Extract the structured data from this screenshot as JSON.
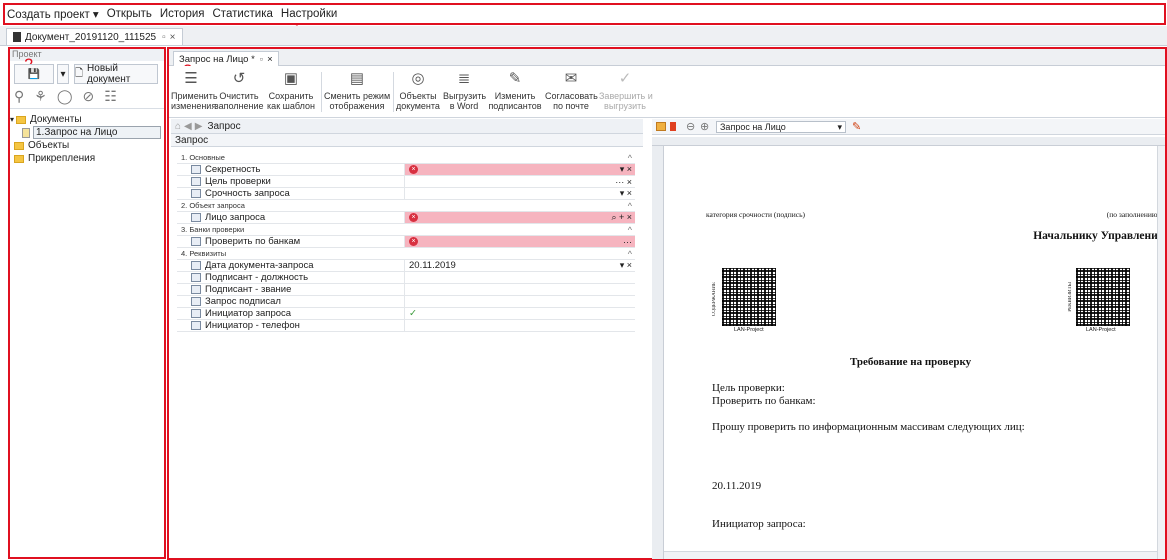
{
  "menu": {
    "items": [
      "Создать проект ▾",
      "Открыть",
      "История",
      "Статистика",
      "Настройки"
    ],
    "marker": "1"
  },
  "doc_tab": {
    "label": "Документ_20191120_111525",
    "pin": "▫",
    "close": "×"
  },
  "left_panel": {
    "title": "Проект",
    "marker": "2",
    "new_doc_label": "Новый документ",
    "tree": [
      {
        "label": "Документы",
        "level": 0
      },
      {
        "label": "1.Запрос на Лицо",
        "level": 1
      },
      {
        "label": "Объекты",
        "level": 0
      },
      {
        "label": "Прикрепления",
        "level": 0
      }
    ]
  },
  "main_tab": {
    "label": "Запрос на Лицо *",
    "pin": "▫",
    "close": "×",
    "marker": "3"
  },
  "ribbon": [
    {
      "label": "Применить\nизменения",
      "icon": "apply-icon",
      "glyph": "☰"
    },
    {
      "label": "Очистить\nзаполнение",
      "icon": "reset-icon",
      "glyph": "↺"
    },
    {
      "label": "Сохранить\nкак шаблон",
      "icon": "save-template-icon",
      "glyph": "▣"
    },
    {
      "label": "Сменить режим\nотображения",
      "icon": "display-mode-icon",
      "glyph": "▤"
    },
    {
      "label": "Объекты\nдокумента",
      "icon": "objects-icon",
      "glyph": "◎"
    },
    {
      "label": "Выгрузить\nв Word",
      "icon": "export-word-icon",
      "glyph": "≣"
    },
    {
      "label": "Изменить\nподписантов",
      "icon": "signers-icon",
      "glyph": "✎"
    },
    {
      "label": "Согласовать\nпо почте",
      "icon": "mail-icon",
      "glyph": "✉"
    },
    {
      "label": "Завершить и\nвыгрузить",
      "icon": "finish-icon",
      "glyph": "✓"
    }
  ],
  "form": {
    "breadcrumb": "Запрос",
    "header": "Запрос",
    "groups": [
      {
        "title": "1. Основные",
        "rows": [
          {
            "label": "Секретность",
            "value": "",
            "required": true,
            "actions": "▾ ×"
          },
          {
            "label": "Цель проверки",
            "value": "",
            "required": false,
            "actions": "··· ×"
          },
          {
            "label": "Срочность запроса",
            "value": "",
            "required": false,
            "actions": "▾ ×"
          }
        ]
      },
      {
        "title": "2. Объект запроса",
        "rows": [
          {
            "label": "Лицо запроса",
            "value": "",
            "required": true,
            "actions": "⌕ + ×"
          }
        ]
      },
      {
        "title": "3. Банки проверки",
        "rows": [
          {
            "label": "Проверить по банкам",
            "value": "",
            "required": true,
            "actions": "···"
          }
        ]
      },
      {
        "title": "4. Реквизиты",
        "rows": [
          {
            "label": "Дата документа-запроса",
            "value": "20.11.2019",
            "required": false,
            "actions": "▾ ×"
          },
          {
            "label": "Подписант - должность",
            "value": "",
            "required": false,
            "actions": ""
          },
          {
            "label": "Подписант - звание",
            "value": "",
            "required": false,
            "actions": ""
          },
          {
            "label": "Запрос подписал",
            "value": "",
            "required": false,
            "actions": ""
          },
          {
            "label": "Инициатор запроса",
            "value": "✓",
            "required": false,
            "actions": ""
          },
          {
            "label": "Инициатор - телефон",
            "value": "",
            "required": false,
            "actions": ""
          }
        ]
      }
    ]
  },
  "preview": {
    "select_value": "Запрос на Лицо",
    "page": {
      "cat_left": "категория срочности (подпись)",
      "cat_right": "(по заполнению)",
      "addressee": "Начальнику Управления",
      "qr_left_caption": "LAN-Project",
      "qr_left_side": "СОДЕРЖАНИЕ",
      "qr_right_caption": "LAN-Project",
      "qr_right_side": "РЕКВИЗИТЫ",
      "title": "Требование на проверку",
      "line1": "Цель проверки:",
      "line2": "Проверить по банкам:",
      "line3": "Прошу проверить по информационным массивам следующих лиц:",
      "date": "20.11.2019",
      "initiator": "Инициатор запроса:"
    }
  }
}
